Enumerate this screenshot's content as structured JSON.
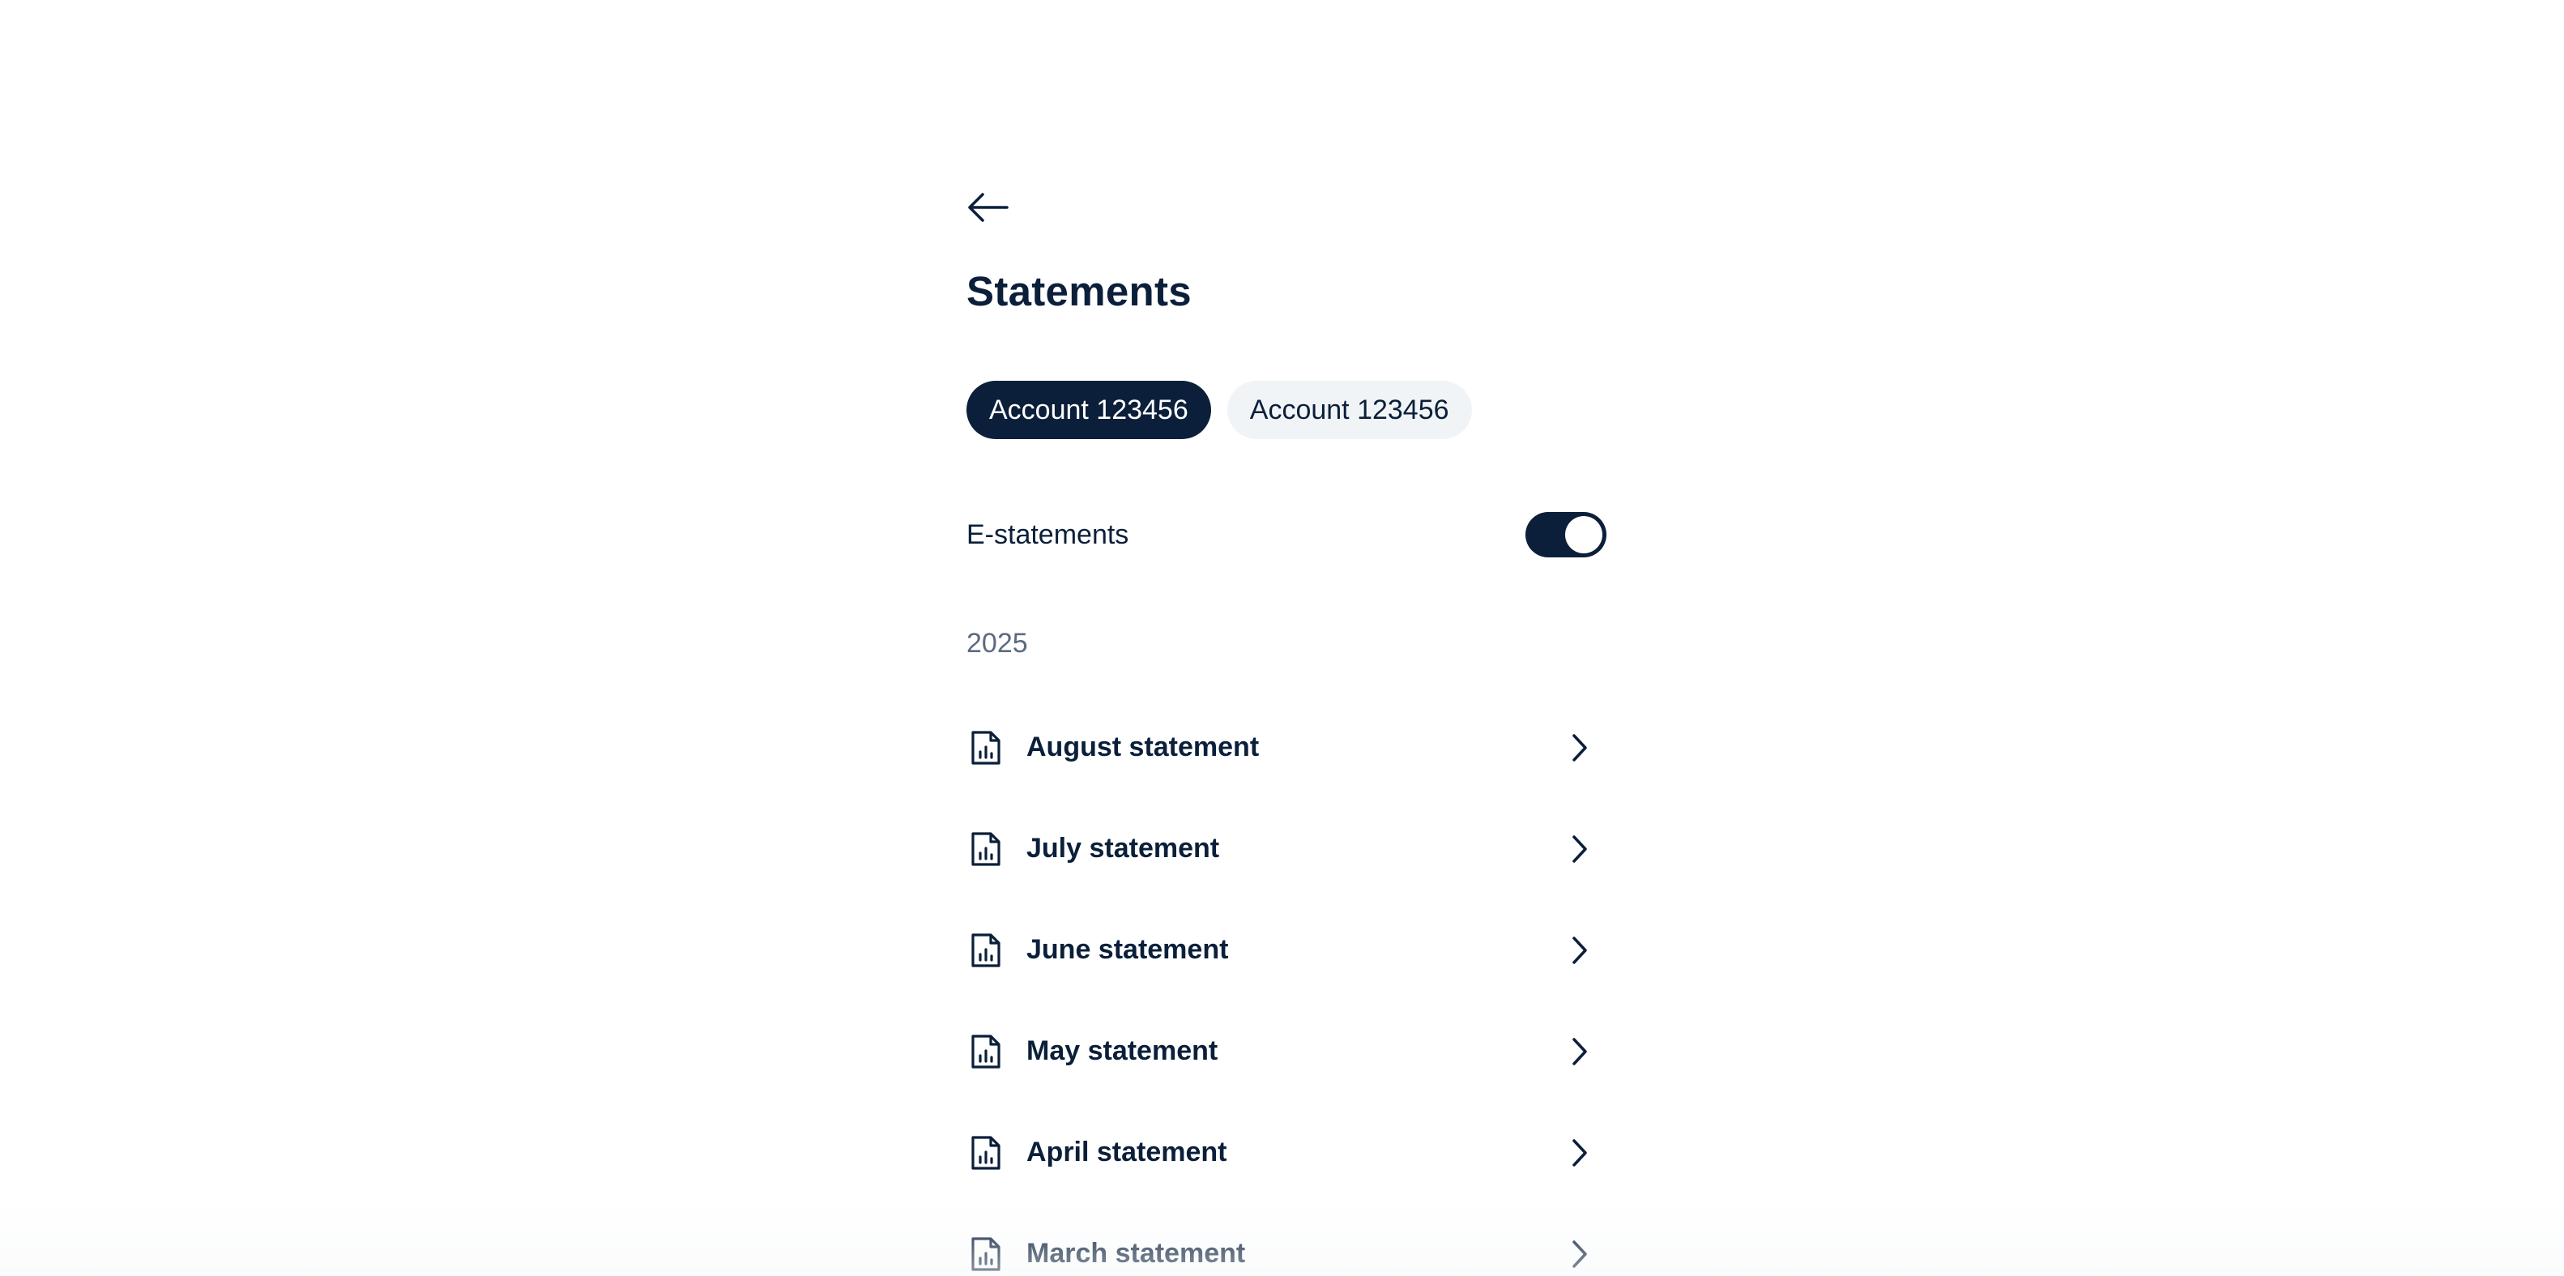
{
  "header": {
    "back_icon": "arrow-left-icon",
    "title": "Statements"
  },
  "tabs": [
    {
      "label": "Account 123456",
      "active": true
    },
    {
      "label": "Account 123456",
      "active": false
    }
  ],
  "estatements": {
    "label": "E-statements",
    "enabled": true
  },
  "statements": {
    "year": "2025",
    "items": [
      {
        "label": "August statement",
        "icon": "document-chart-icon"
      },
      {
        "label": "July statement",
        "icon": "document-chart-icon"
      },
      {
        "label": "June statement",
        "icon": "document-chart-icon"
      },
      {
        "label": "May statement",
        "icon": "document-chart-icon"
      },
      {
        "label": "April statement",
        "icon": "document-chart-icon"
      },
      {
        "label": "March statement",
        "icon": "document-chart-icon"
      }
    ]
  },
  "colors": {
    "primary": "#0b1f3a",
    "inactive_tab_bg": "#f1f4f7",
    "muted_text": "#5d6b80",
    "background": "#ffffff"
  }
}
